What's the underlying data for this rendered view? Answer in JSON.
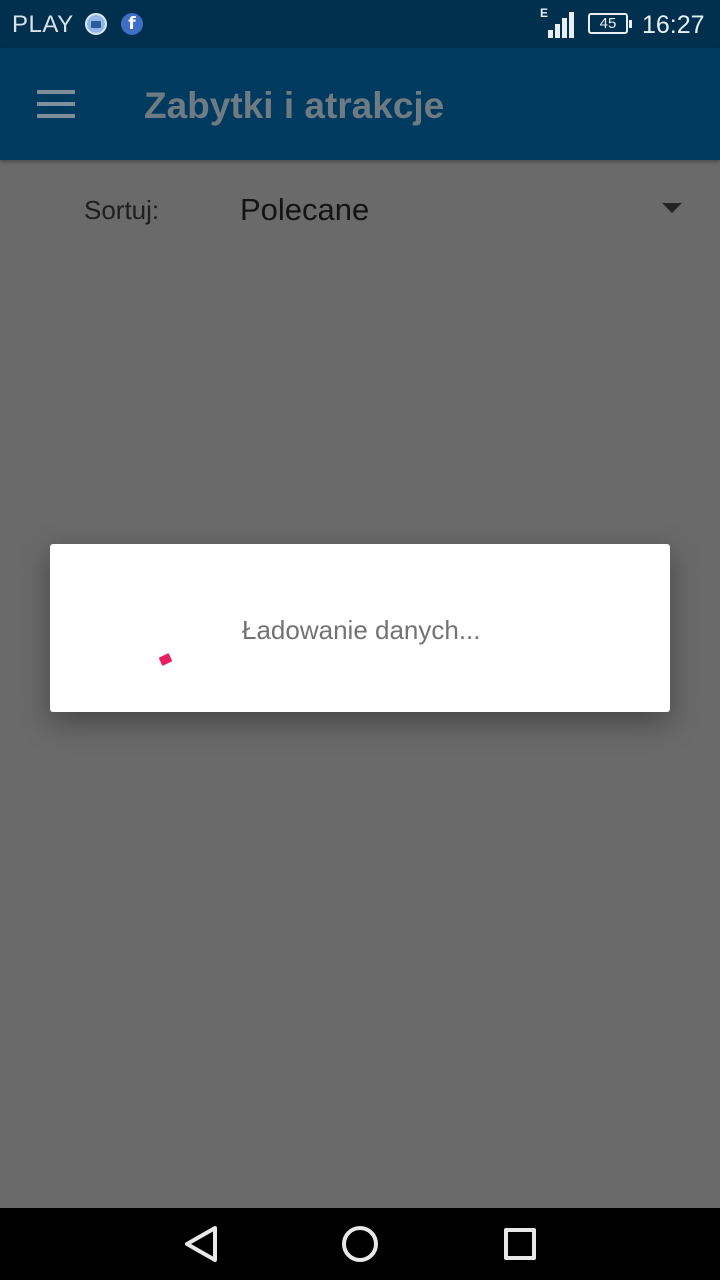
{
  "status_bar": {
    "carrier": "PLAY",
    "network_type": "E",
    "battery_level": "45",
    "time": "16:27",
    "notification_icons": [
      "gallery-icon",
      "facebook-icon"
    ]
  },
  "app_bar": {
    "title": "Zabytki i atrakcje",
    "menu_icon": "hamburger-menu-icon"
  },
  "sort": {
    "label": "Sortuj:",
    "selected": "Polecane"
  },
  "loading_dialog": {
    "message": "Ładowanie danych...",
    "spinner_color": "#e91e63"
  },
  "nav_bar": {
    "buttons": [
      "back",
      "home",
      "recent-apps"
    ]
  },
  "colors": {
    "status_bar": "#00304e",
    "app_bar": "#003a5f",
    "scrim_background": "#6a6a6a",
    "accent": "#e91e63"
  }
}
